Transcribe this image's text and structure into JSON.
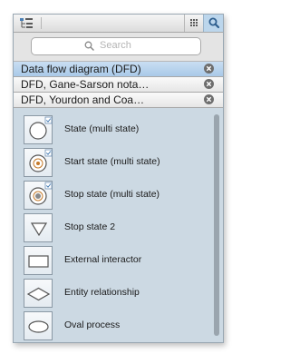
{
  "toolbar": {
    "tree_icon": "library-tree-icon",
    "grid_icon": "grid-view-icon",
    "search_icon": "search-icon"
  },
  "search": {
    "placeholder": "Search"
  },
  "libraries": [
    {
      "label": "Data flow diagram (DFD)",
      "active": true
    },
    {
      "label": "DFD, Gane-Sarson nota…",
      "active": false
    },
    {
      "label": "DFD, Yourdon and Coa…",
      "active": false
    }
  ],
  "shapes": [
    {
      "label": "State (multi state)",
      "icon": "state-multi-icon"
    },
    {
      "label": "Start state (multi state)",
      "icon": "start-state-multi-icon"
    },
    {
      "label": "Stop state (multi state)",
      "icon": "stop-state-multi-icon"
    },
    {
      "label": "Stop state 2",
      "icon": "triangle-icon"
    },
    {
      "label": "External interactor",
      "icon": "rectangle-icon"
    },
    {
      "label": "Entity relationship",
      "icon": "diamond-icon"
    },
    {
      "label": "Oval process",
      "icon": "oval-icon"
    }
  ],
  "colors": {
    "panel_bg": "#ccd9e3",
    "active_library": "#b6d0ec",
    "search_button": "#bcd6ec"
  }
}
